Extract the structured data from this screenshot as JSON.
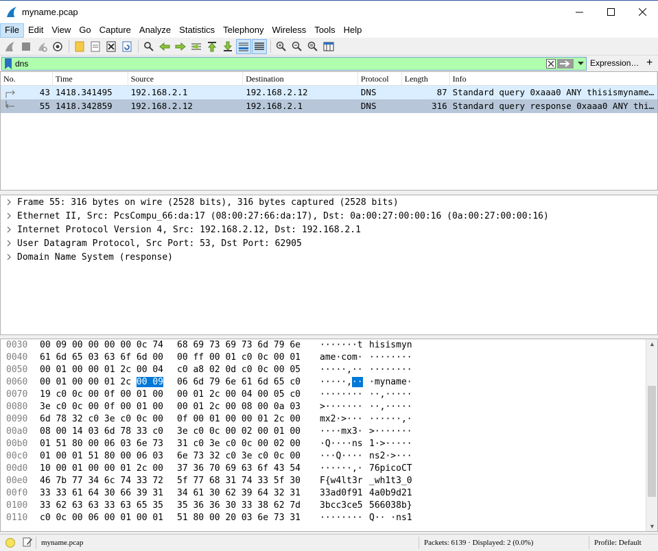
{
  "window": {
    "title": "myname.pcap"
  },
  "menu": [
    "File",
    "Edit",
    "View",
    "Go",
    "Capture",
    "Analyze",
    "Statistics",
    "Telephony",
    "Wireless",
    "Tools",
    "Help"
  ],
  "filter": {
    "value": "dns",
    "expression_label": "Expression…",
    "add_label": "+"
  },
  "packet_list": {
    "columns": [
      "No.",
      "Time",
      "Source",
      "Destination",
      "Protocol",
      "Length",
      "Info"
    ],
    "rows": [
      {
        "no": "43",
        "time": "1418.341495",
        "source": "192.168.2.1",
        "destination": "192.168.2.12",
        "protocol": "DNS",
        "length": "87",
        "info": "Standard query 0xaaa0 ANY thisismyname…"
      },
      {
        "no": "55",
        "time": "1418.342859",
        "source": "192.168.2.12",
        "destination": "192.168.2.1",
        "protocol": "DNS",
        "length": "316",
        "info": "Standard query response 0xaaa0 ANY thi…"
      }
    ]
  },
  "details": [
    "Frame 55: 316 bytes on wire (2528 bits), 316 bytes captured (2528 bits)",
    "Ethernet II, Src: PcsCompu_66:da:17 (08:00:27:66:da:17), Dst: 0a:00:27:00:00:16 (0a:00:27:00:00:16)",
    "Internet Protocol Version 4, Src: 192.168.2.12, Dst: 192.168.2.1",
    "User Datagram Protocol, Src Port: 53, Dst Port: 62905",
    "Domain Name System (response)"
  ],
  "bytes": [
    {
      "off": "0030",
      "hex1": "00 09 00 00 00 00 0c 74",
      "hex2": "68 69 73 69 73 6d 79 6e",
      "asc1": "·······t",
      "asc2": "hisismyn"
    },
    {
      "off": "0040",
      "hex1": "61 6d 65 03 63 6f 6d 00",
      "hex2": "00 ff 00 01 c0 0c 00 01",
      "asc1": "ame·com·",
      "asc2": "········"
    },
    {
      "off": "0050",
      "hex1": "00 01 00 00 01 2c 00 04",
      "hex2": "c0 a8 02 0d c0 0c 00 05",
      "asc1": "·····,··",
      "asc2": "········"
    },
    {
      "off": "0060",
      "hex1a": "00 01 00 00 01 2c ",
      "hex1hl": "00 09",
      "hex2": "06 6d 79 6e 61 6d 65 c0",
      "asc1a": "·····,",
      "asc1hl": "··",
      "asc2": "·myname·"
    },
    {
      "off": "0070",
      "hex1": "19 c0 0c 00 0f 00 01 00",
      "hex2": "00 01 2c 00 04 00 05 c0",
      "asc1": "········",
      "asc2": "··,·····"
    },
    {
      "off": "0080",
      "hex1": "3e c0 0c 00 0f 00 01 00",
      "hex2": "00 01 2c 00 08 00 0a 03",
      "asc1": ">·······",
      "asc2": "··,·····"
    },
    {
      "off": "0090",
      "hex1": "6d 78 32 c0 3e c0 0c 00",
      "hex2": "0f 00 01 00 00 01 2c 00",
      "asc1": "mx2·>···",
      "asc2": "······,·"
    },
    {
      "off": "00a0",
      "hex1": "08 00 14 03 6d 78 33 c0",
      "hex2": "3e c0 0c 00 02 00 01 00",
      "asc1": "····mx3·",
      "asc2": ">·······"
    },
    {
      "off": "00b0",
      "hex1": "01 51 80 00 06 03 6e 73",
      "hex2": "31 c0 3e c0 0c 00 02 00",
      "asc1": "·Q····ns",
      "asc2": "1·>·····"
    },
    {
      "off": "00c0",
      "hex1": "01 00 01 51 80 00 06 03",
      "hex2": "6e 73 32 c0 3e c0 0c 00",
      "asc1": "···Q····",
      "asc2": "ns2·>···"
    },
    {
      "off": "00d0",
      "hex1": "10 00 01 00 00 01 2c 00",
      "hex2": "37 36 70 69 63 6f 43 54",
      "asc1": "······,·",
      "asc2": "76picoCT"
    },
    {
      "off": "00e0",
      "hex1": "46 7b 77 34 6c 74 33 72",
      "hex2": "5f 77 68 31 74 33 5f 30",
      "asc1": "F{w4lt3r",
      "asc2": "_wh1t3_0"
    },
    {
      "off": "00f0",
      "hex1": "33 33 61 64 30 66 39 31",
      "hex2": "34 61 30 62 39 64 32 31",
      "asc1": "33ad0f91",
      "asc2": "4a0b9d21"
    },
    {
      "off": "0100",
      "hex1": "33 62 63 63 33 63 65 35",
      "hex2": "35 36 36 30 33 38 62 7d",
      "asc1": "3bcc3ce5",
      "asc2": "566038b}"
    },
    {
      "off": "0110",
      "hex1": "c0 0c 00 06 00 01 00 01",
      "hex2": "51 80 00 20 03 6e 73 31",
      "asc1": "········",
      "asc2": "Q·· ·ns1"
    }
  ],
  "status": {
    "file": "myname.pcap",
    "packets": "Packets: 6139 · Displayed: 2 (0.0%)",
    "profile": "Profile: Default"
  },
  "colors": {
    "filter_ok": "#afffaf",
    "row_selected": "#b7c7d9",
    "row_related": "#daeeff",
    "highlight": "#0078d7"
  }
}
